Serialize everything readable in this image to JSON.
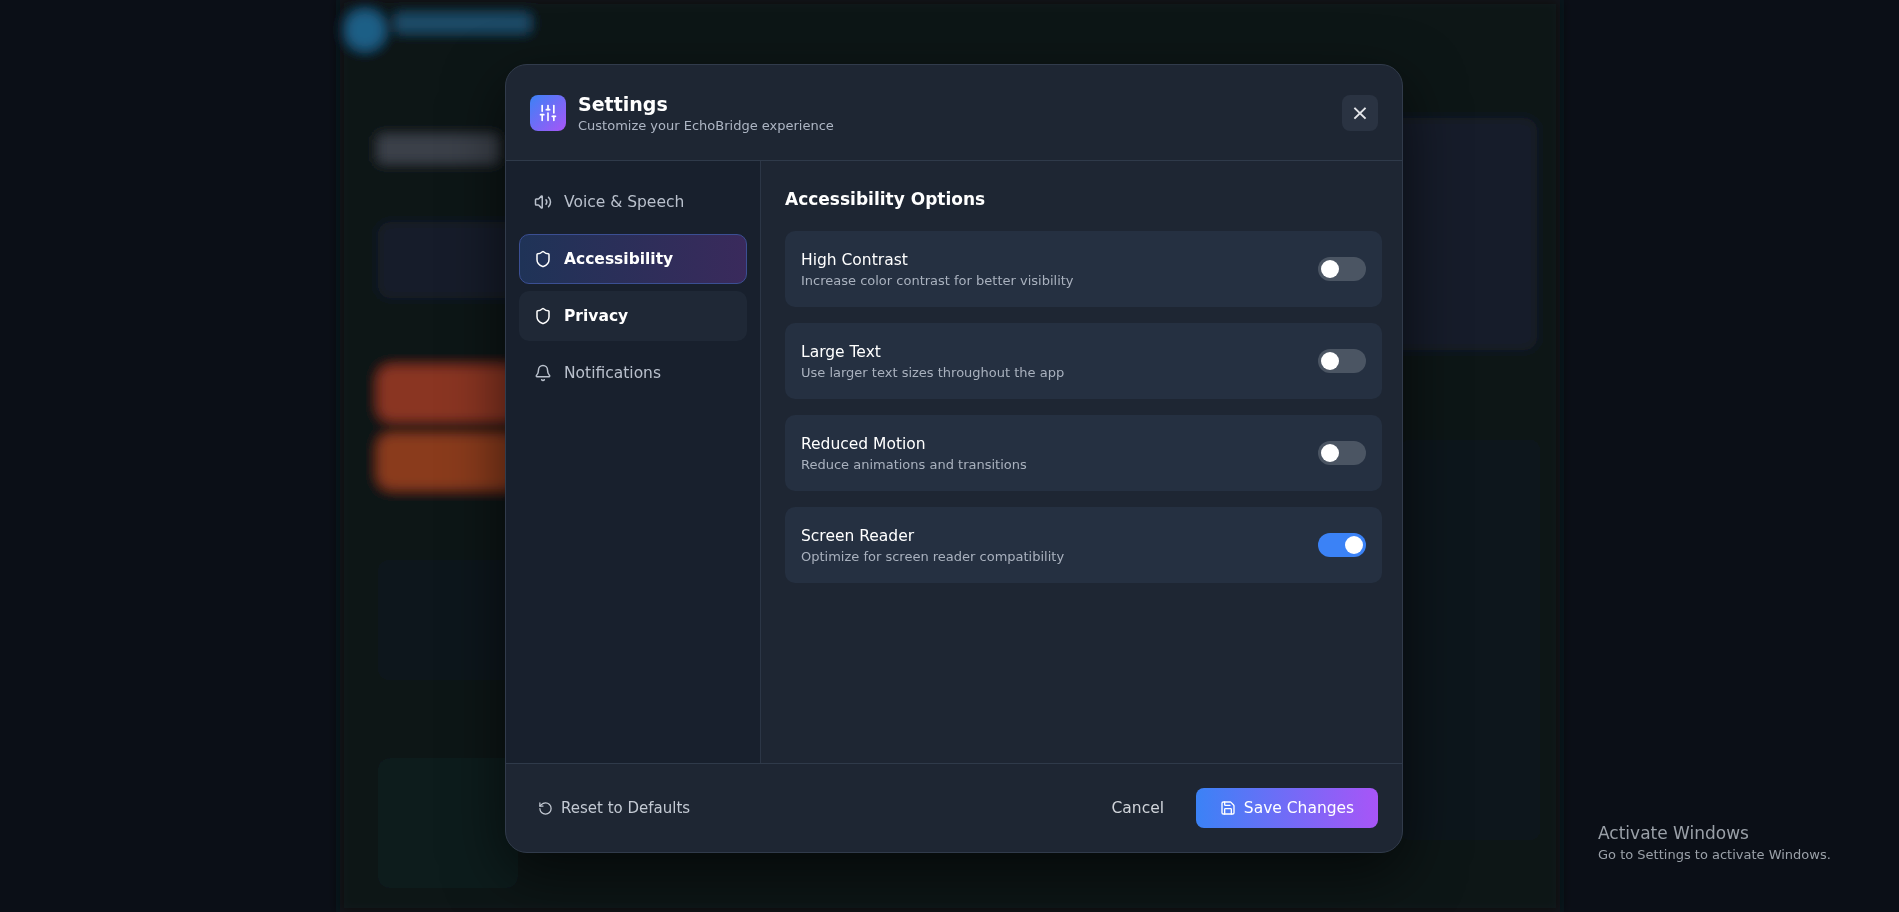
{
  "dialog": {
    "title": "Settings",
    "subtitle": "Customize your EchoBridge experience",
    "close_label": "×"
  },
  "sidebar": {
    "items": [
      {
        "label": "Voice & Speech",
        "kind": "speaker",
        "selected": false,
        "hovered": false
      },
      {
        "label": "Accessibility",
        "kind": "shield",
        "selected": true,
        "hovered": false
      },
      {
        "label": "Privacy",
        "kind": "shield",
        "selected": false,
        "hovered": true
      },
      {
        "label": "Notifications",
        "kind": "bell",
        "selected": false,
        "hovered": false
      }
    ]
  },
  "content": {
    "heading": "Accessibility Options",
    "options": [
      {
        "title": "High Contrast",
        "description": "Increase color contrast for better visibility",
        "on": false
      },
      {
        "title": "Large Text",
        "description": "Use larger text sizes throughout the app",
        "on": false
      },
      {
        "title": "Reduced Motion",
        "description": "Reduce animations and transitions",
        "on": false
      },
      {
        "title": "Screen Reader",
        "description": "Optimize for screen reader compatibility",
        "on": true
      }
    ]
  },
  "footer": {
    "reset": "Reset to Defaults",
    "cancel": "Cancel",
    "save": "Save Changes"
  },
  "os_notice": {
    "title": "Activate Windows",
    "text": "Go to Settings to activate Windows."
  }
}
